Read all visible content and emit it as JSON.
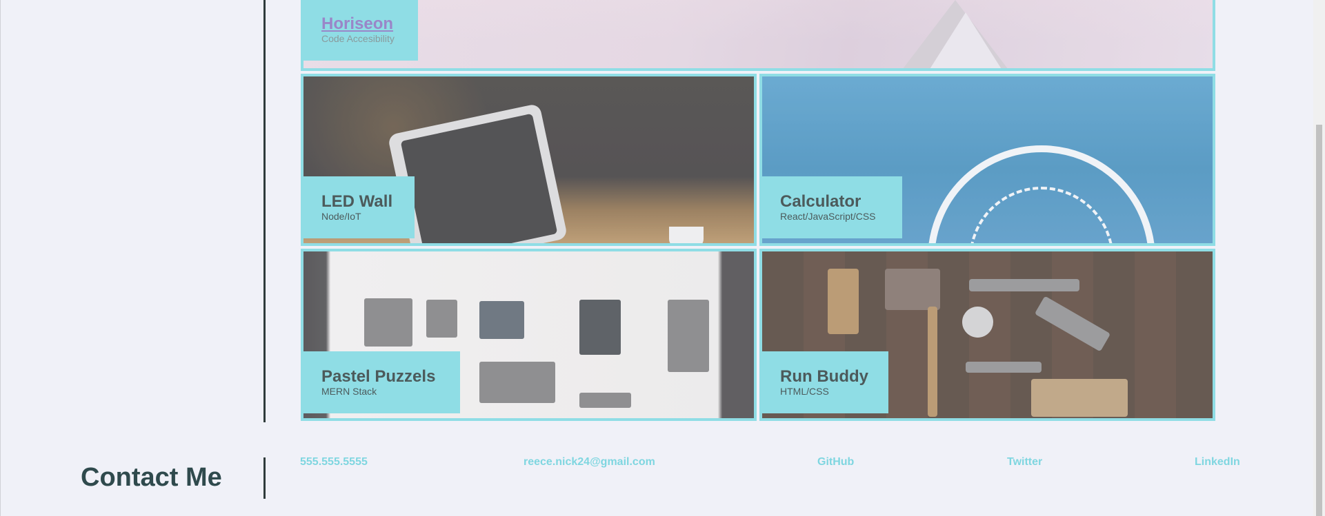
{
  "projects": [
    {
      "id": "horiseon",
      "title": "Horiseon",
      "subtitle": "Code Accesibility"
    },
    {
      "id": "led",
      "title": "LED Wall",
      "subtitle": "Node/IoT"
    },
    {
      "id": "calc",
      "title": "Calculator",
      "subtitle": "React/JavaScript/CSS"
    },
    {
      "id": "pastel",
      "title": "Pastel Puzzels",
      "subtitle": "MERN Stack"
    },
    {
      "id": "run",
      "title": "Run Buddy",
      "subtitle": "HTML/CSS"
    }
  ],
  "contact": {
    "heading": "Contact Me",
    "phone": "555.555.5555",
    "email": "reece.nick24@gmail.com",
    "github": "GitHub",
    "twitter": "Twitter",
    "linkedin": "LinkedIn"
  },
  "colors": {
    "accent": "#8fdde5",
    "link": "#7fd6e0",
    "heading": "#2f4a4d",
    "background": "#f0f1f8"
  }
}
